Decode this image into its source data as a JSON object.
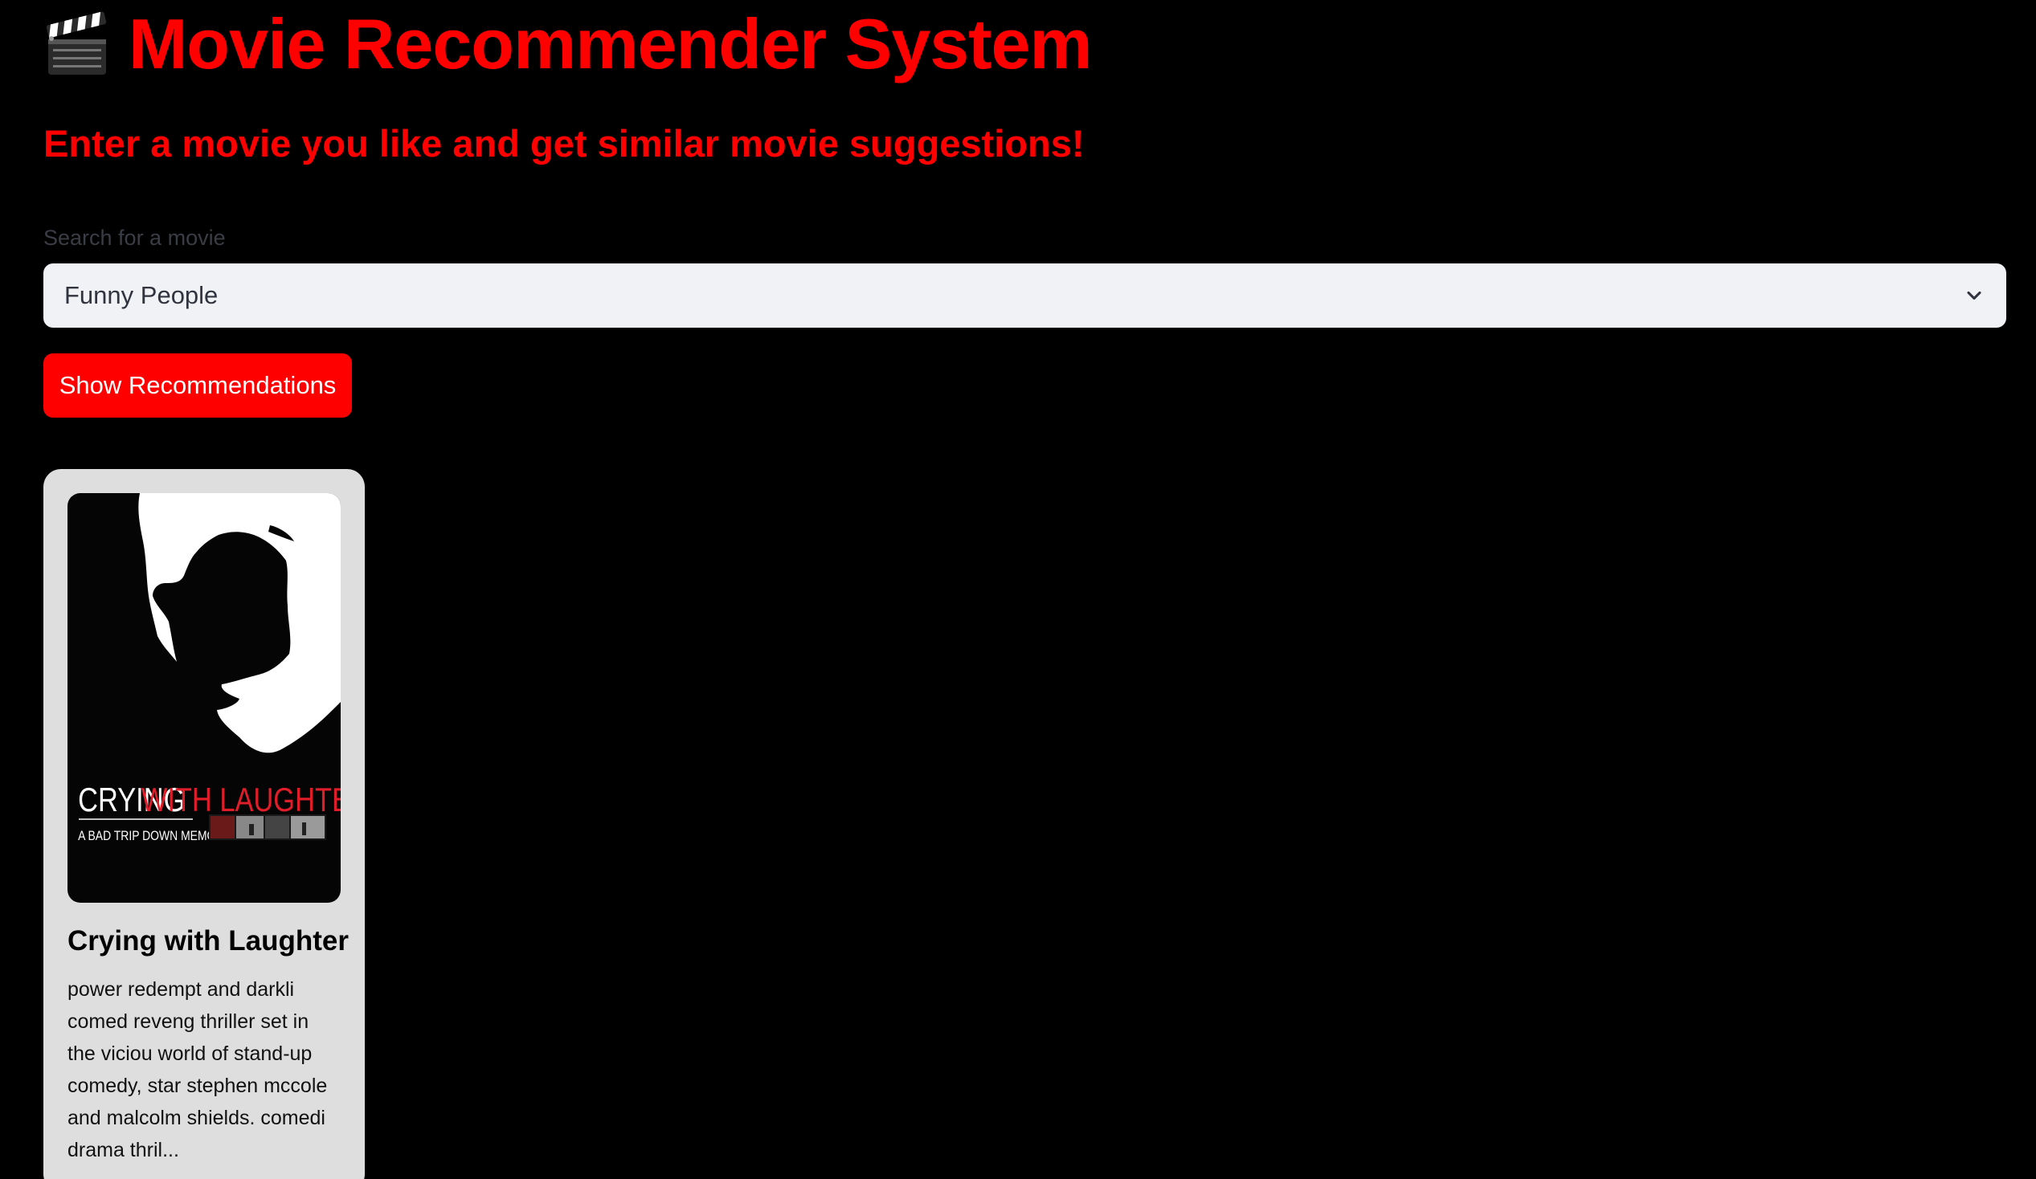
{
  "header": {
    "icon": "clapperboard-icon",
    "title": "Movie Recommender System",
    "subtitle": "Enter a movie you like and get similar movie suggestions!"
  },
  "search": {
    "label": "Search for a movie",
    "selected_value": "Funny People"
  },
  "actions": {
    "show_label": "Show Recommendations"
  },
  "recommendations": [
    {
      "title": "Crying with Laughter",
      "description": "power redempt and darkli comed reveng thriller set in the viciou world of stand-up comedy, star stephen mccole and malcolm shields. comedi drama thril...",
      "poster": {
        "title_part1": "CRYING",
        "title_part2": "WITH LAUGHTER",
        "tagline": "A BAD TRIP DOWN MEMORY LANE"
      }
    }
  ],
  "colors": {
    "background": "#000000",
    "accent": "#ff0000",
    "select_bg": "#f0f2f6",
    "card_bg": "#dedede"
  }
}
